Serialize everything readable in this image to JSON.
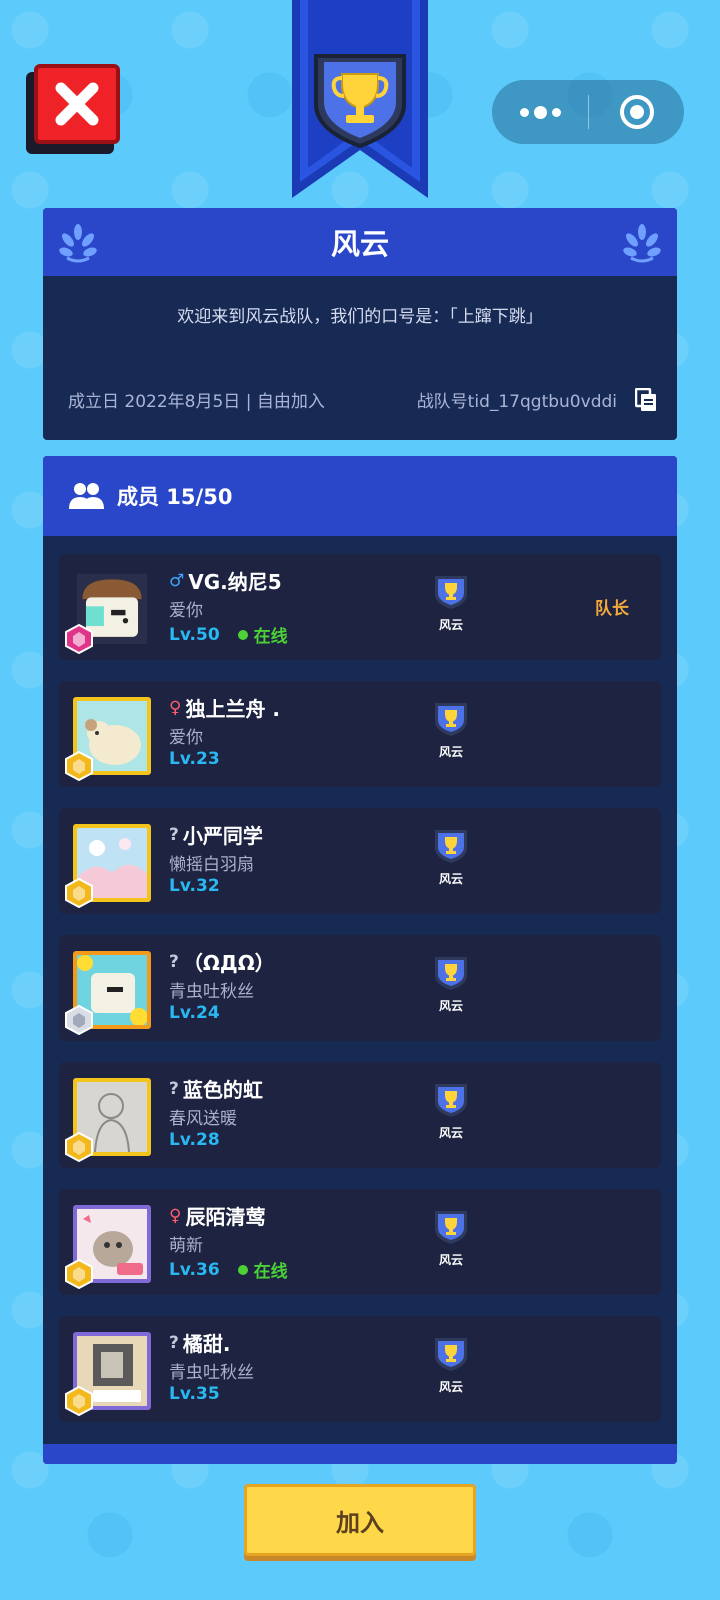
{
  "window": {
    "close_icon": "close-icon",
    "more_icon": "more-dots-icon",
    "target_icon": "target-icon"
  },
  "team": {
    "name": "风云",
    "slogan": "欢迎来到风云战队，我们的口号是：「上蹿下跳」",
    "founded_info": "成立日 2022年8月5日 | 自由加入",
    "team_id": "战队号tid_17qgtbu0vddi",
    "emblem_icon": "trophy-shield-icon"
  },
  "members_header": {
    "title": "成员 15/50",
    "icon": "group-icon"
  },
  "members": [
    {
      "gender": "♂",
      "gender_type": "male",
      "name": "VG.纳尼5",
      "signature": "爱你",
      "level": "Lv.50",
      "online": "在线",
      "team_label": "风云",
      "role": "队长"
    },
    {
      "gender": "♀",
      "gender_type": "female",
      "name": "独上兰舟 .",
      "signature": "爱你",
      "level": "Lv.23",
      "online": "",
      "team_label": "风云",
      "role": ""
    },
    {
      "gender": "?",
      "gender_type": "unknown",
      "name": "小严同学",
      "signature": "懒摇白羽扇",
      "level": "Lv.32",
      "online": "",
      "team_label": "风云",
      "role": ""
    },
    {
      "gender": "?",
      "gender_type": "unknown",
      "name": "（ΩДΩ）",
      "signature": "青虫吐秋丝",
      "level": "Lv.24",
      "online": "",
      "team_label": "风云",
      "role": ""
    },
    {
      "gender": "?",
      "gender_type": "unknown",
      "name": "蓝色的虹",
      "signature": "春风送暖",
      "level": "Lv.28",
      "online": "",
      "team_label": "风云",
      "role": ""
    },
    {
      "gender": "♀",
      "gender_type": "female",
      "name": "辰陌清莺",
      "signature": "萌新",
      "level": "Lv.36",
      "online": "在线",
      "team_label": "风云",
      "role": ""
    },
    {
      "gender": "?",
      "gender_type": "unknown",
      "name": "橘甜.",
      "signature": "青虫吐秋丝",
      "level": "Lv.35",
      "online": "",
      "team_label": "风云",
      "role": ""
    }
  ],
  "join_button": "加入",
  "colors": {
    "background": "#5ccbfb",
    "panel": "#172a54",
    "header_blue": "#2a47c9",
    "level_blue": "#2ab8f2",
    "online_green": "#4cd137",
    "leader_orange": "#f2a93b",
    "join_yellow": "#ffd84a"
  }
}
